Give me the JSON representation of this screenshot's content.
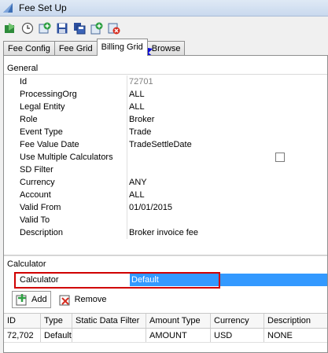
{
  "window": {
    "title": "Fee Set Up"
  },
  "toolbar": {
    "buttons": [
      {
        "icon": "save-green-icon"
      },
      {
        "icon": "clock-icon"
      },
      {
        "icon": "add-icon"
      },
      {
        "icon": "floppy-icon"
      },
      {
        "icon": "copy-icon"
      },
      {
        "icon": "new-icon"
      },
      {
        "icon": "delete-icon"
      }
    ]
  },
  "tabs": [
    {
      "label": "Fee Config",
      "active": false
    },
    {
      "label": "Fee Grid",
      "active": false
    },
    {
      "label": "Billing Grid",
      "active": true
    },
    {
      "label": "Browse",
      "active": false
    }
  ],
  "general": {
    "heading": "General",
    "rows": [
      {
        "label": "Id",
        "value": "72701",
        "readonly": true
      },
      {
        "label": "ProcessingOrg",
        "value": "ALL"
      },
      {
        "label": "Legal Entity",
        "value": "ALL"
      },
      {
        "label": "Role",
        "value": "Broker"
      },
      {
        "label": "Event Type",
        "value": "Trade"
      },
      {
        "label": "Fee Value Date",
        "value": "TradeSettleDate"
      },
      {
        "label": "Use Multiple Calculators",
        "value": "",
        "checkbox": true
      },
      {
        "label": "SD Filter",
        "value": ""
      },
      {
        "label": "Currency",
        "value": "ANY"
      },
      {
        "label": "Account",
        "value": "ALL"
      },
      {
        "label": "Valid From",
        "value": "01/01/2015"
      },
      {
        "label": "Valid To",
        "value": ""
      },
      {
        "label": "Description",
        "value": "Broker invoice fee"
      }
    ]
  },
  "calculator": {
    "heading": "Calculator",
    "label": "Calculator",
    "value": "Default",
    "add_label": "Add",
    "remove_label": "Remove"
  },
  "grid": {
    "columns": [
      "ID",
      "Type",
      "Static Data Filter",
      "Amount Type",
      "Currency",
      "Description"
    ],
    "rows": [
      [
        "72,702",
        "Default",
        "",
        "AMOUNT",
        "USD",
        "NONE"
      ]
    ]
  }
}
